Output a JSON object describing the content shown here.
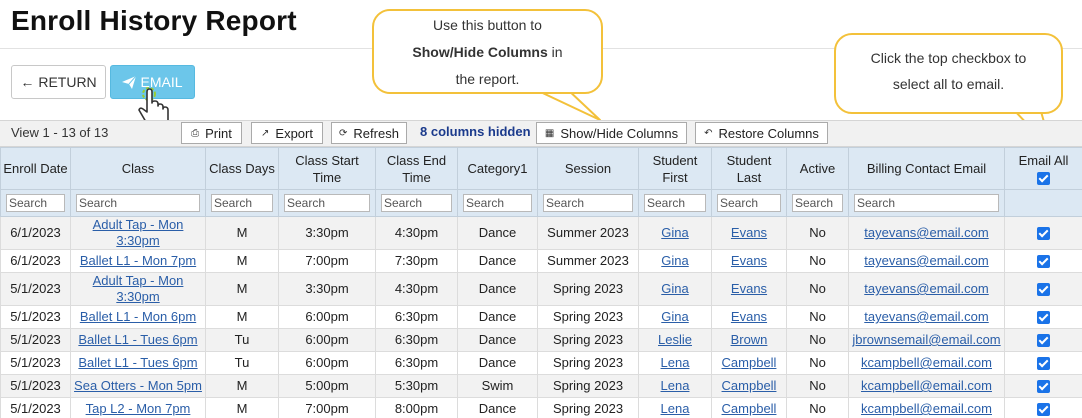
{
  "page": {
    "title": "Enroll History Report"
  },
  "actions": {
    "return_label": "RETURN",
    "email_label": "EMAIL"
  },
  "callouts": {
    "show_hide": {
      "line1": "Use this button to",
      "bold": "Show/Hide Columns",
      "after_bold": " in",
      "line3": "the report."
    },
    "select_all": {
      "line1": "Click the top checkbox to",
      "line2": "select all to email."
    }
  },
  "toolbar": {
    "view_info": "View 1 - 13 of 13",
    "print": "Print",
    "export": "Export",
    "refresh": "Refresh",
    "columns_hidden": "8 columns hidden",
    "show_hide": "Show/Hide Columns",
    "restore": "Restore Columns"
  },
  "table": {
    "headers": [
      "Enroll Date",
      "Class",
      "Class Days",
      "Class Start Time",
      "Class End Time",
      "Category1",
      "Session",
      "Student First",
      "Student Last",
      "Active",
      "Billing Contact Email",
      "Email All"
    ],
    "search_placeholder": "Search",
    "rows": [
      {
        "date": "6/1/2023",
        "class": "Adult Tap - Mon 3:30pm",
        "days": "M",
        "start": "3:30pm",
        "end": "4:30pm",
        "category": "Dance",
        "session": "Summer 2023",
        "first": "Gina",
        "last": "Evans",
        "active": "No",
        "email": "tayevans@email.com",
        "checked": true
      },
      {
        "date": "6/1/2023",
        "class": "Ballet L1 - Mon 7pm",
        "days": "M",
        "start": "7:00pm",
        "end": "7:30pm",
        "category": "Dance",
        "session": "Summer 2023",
        "first": "Gina",
        "last": "Evans",
        "active": "No",
        "email": "tayevans@email.com",
        "checked": true
      },
      {
        "date": "5/1/2023",
        "class": "Adult Tap - Mon 3:30pm",
        "days": "M",
        "start": "3:30pm",
        "end": "4:30pm",
        "category": "Dance",
        "session": "Spring 2023",
        "first": "Gina",
        "last": "Evans",
        "active": "No",
        "email": "tayevans@email.com",
        "checked": true
      },
      {
        "date": "5/1/2023",
        "class": "Ballet L1 - Mon 6pm",
        "days": "M",
        "start": "6:00pm",
        "end": "6:30pm",
        "category": "Dance",
        "session": "Spring 2023",
        "first": "Gina",
        "last": "Evans",
        "active": "No",
        "email": "tayevans@email.com",
        "checked": true
      },
      {
        "date": "5/1/2023",
        "class": "Ballet L1 - Tues 6pm",
        "days": "Tu",
        "start": "6:00pm",
        "end": "6:30pm",
        "category": "Dance",
        "session": "Spring 2023",
        "first": "Leslie",
        "last": "Brown",
        "active": "No",
        "email": "jbrownsemail@email.com",
        "checked": true
      },
      {
        "date": "5/1/2023",
        "class": "Ballet L1 - Tues 6pm",
        "days": "Tu",
        "start": "6:00pm",
        "end": "6:30pm",
        "category": "Dance",
        "session": "Spring 2023",
        "first": "Lena",
        "last": "Campbell",
        "active": "No",
        "email": "kcampbell@email.com",
        "checked": true
      },
      {
        "date": "5/1/2023",
        "class": "Sea Otters - Mon 5pm",
        "days": "M",
        "start": "5:00pm",
        "end": "5:30pm",
        "category": "Swim",
        "session": "Spring 2023",
        "first": "Lena",
        "last": "Campbell",
        "active": "No",
        "email": "kcampbell@email.com",
        "checked": true
      },
      {
        "date": "5/1/2023",
        "class": "Tap L2 - Mon 7pm",
        "days": "M",
        "start": "7:00pm",
        "end": "8:00pm",
        "category": "Dance",
        "session": "Spring 2023",
        "first": "Lena",
        "last": "Campbell",
        "active": "No",
        "email": "kcampbell@email.com",
        "checked": true
      }
    ]
  },
  "colors": {
    "email_button": "#6cc6ea",
    "header_bg": "#dce8f3",
    "callout_border": "#f3c13a",
    "link": "#2a5ea8",
    "checkbox": "#1a73e8"
  }
}
